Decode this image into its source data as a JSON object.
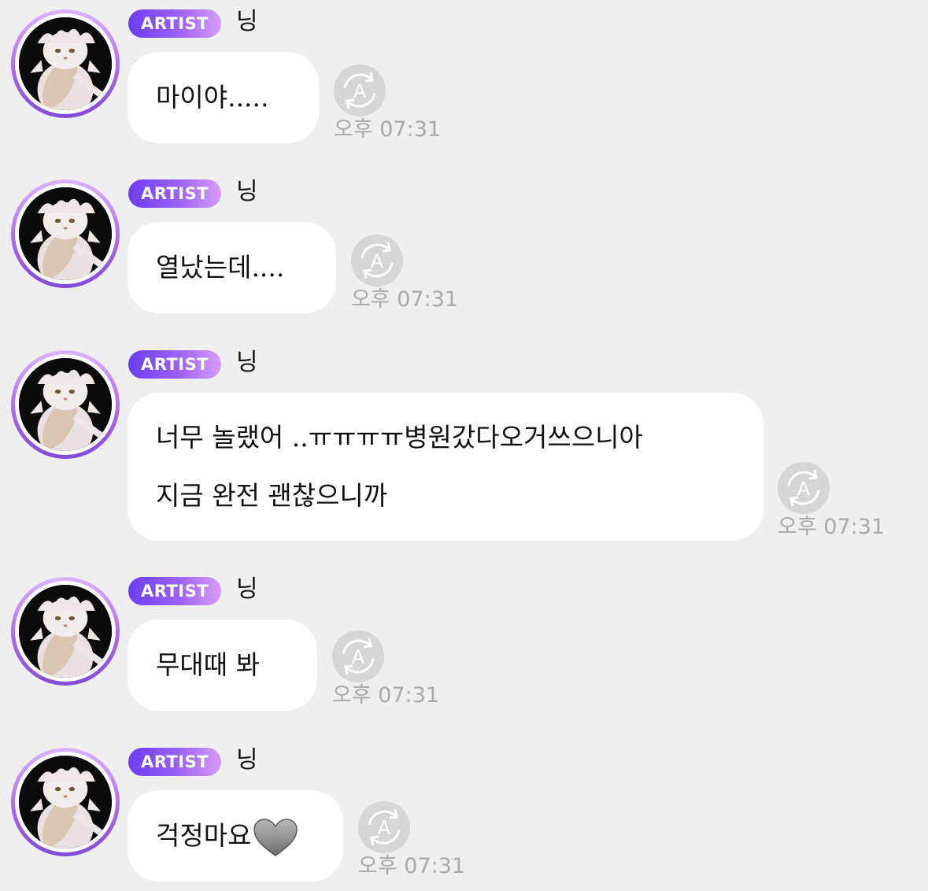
{
  "colors": {
    "background": "#efefef",
    "bubble": "#ffffff",
    "badge_start": "#6b3df0",
    "badge_end": "#d79df8",
    "avatar_ring": "#a96af2",
    "timestamp": "#a8a8a8"
  },
  "icons": {
    "avatar": "white-cat-photo",
    "translate": "translate-a-icon",
    "heart": "gray-heart-emoji"
  },
  "messages": [
    {
      "badge": "ARTIST",
      "sender": "닝",
      "lines": [
        "마이야....."
      ],
      "time": "오후 07:31"
    },
    {
      "badge": "ARTIST",
      "sender": "닝",
      "lines": [
        "열났는데...."
      ],
      "time": "오후 07:31"
    },
    {
      "badge": "ARTIST",
      "sender": "닝",
      "lines": [
        "너무 놀랬어 ..ㅠㅠㅠㅠ병원갔다오거쓰으니아",
        "지금 완전 괜찮으니까"
      ],
      "time": "오후 07:31"
    },
    {
      "badge": "ARTIST",
      "sender": "닝",
      "lines": [
        "무대때 봐"
      ],
      "time": "오후 07:31"
    },
    {
      "badge": "ARTIST",
      "sender": "닝",
      "lines": [
        "걱정마요"
      ],
      "time": "오후 07:31"
    }
  ]
}
